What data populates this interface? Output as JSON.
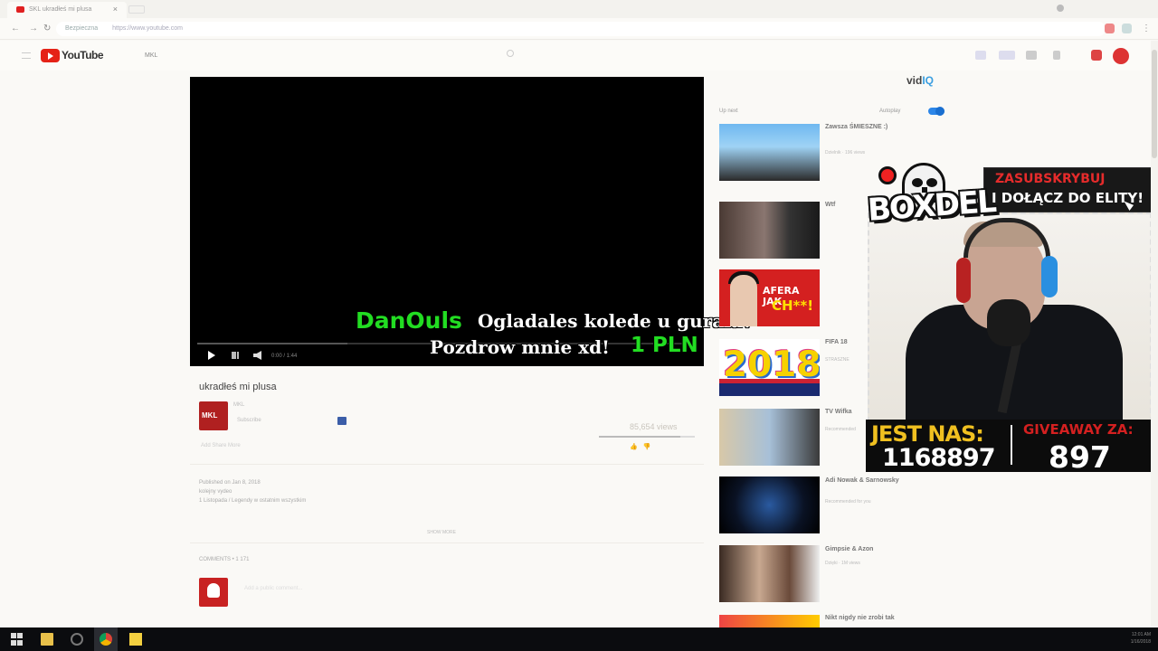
{
  "browser": {
    "tab_title": "SKL ukradłeś mi plusa",
    "tab_close": "×",
    "secure_label": "Bezpieczna",
    "url": "https://www.youtube.com"
  },
  "youtube": {
    "logo_text": "YouTube",
    "search_value": "MKL"
  },
  "player": {
    "time_text": "0:00 / 1:44",
    "progress_fraction": 0.3
  },
  "donation": {
    "donor": "DanOuls",
    "message_line1": "Ogladales kolede u gurala?",
    "message_line2": "Pozdrow mnie xd!",
    "amount": "1 PLN"
  },
  "video": {
    "title": "ukradłeś mi plusa",
    "channel_avatar_text": "MKL",
    "channel": "MKL",
    "subscribe_text": "Subscribe",
    "views": "85,654 views",
    "like_ratio": 0.85,
    "actions": "Add  Share  More",
    "published": "Published on Jan 8, 2018",
    "desc_line1": "kolejny vydeo",
    "desc_line2": "1 Listopada / Legendy w ostatnim wszystkim",
    "show_more": "SHOW MORE",
    "comments_header": "COMMENTS • 1 171",
    "comment_placeholder": "Add a public comment..."
  },
  "sidebar": {
    "vidiq_prefix": "vid",
    "vidiq_suffix": "IQ",
    "up_next": "Up next",
    "autoplay": "Autoplay",
    "items": [
      {
        "title": "Zawsza ŚMIESZNE :)",
        "meta": "Dzielnik · 196 views"
      },
      {
        "title": "Wtf",
        "meta": ""
      },
      {
        "title": "",
        "meta": ""
      },
      {
        "title": "FIFA 18",
        "meta": "STRASZNE"
      },
      {
        "title": "TV Wifka",
        "meta": "Recommended"
      },
      {
        "title": "Adi Nowak & Sarnowsky",
        "meta": "Recommended for you"
      },
      {
        "title": "Gimpsie & Azon",
        "meta": "Dzięki · 1M views"
      },
      {
        "title": "Nikt nigdy nie zrobi tak",
        "meta": ""
      }
    ],
    "thumb3_caption1": "AFERA JAK",
    "thumb3_caption2": "CH**!",
    "thumb4_year": "2018"
  },
  "overlay": {
    "logo": "BOXDEL",
    "banner_line1": "ZASUBSKRYBUJ",
    "banner_line2": "I DOŁĄCZ DO ELITY!",
    "jest_nas_label": "JEST NAS:",
    "jest_nas_count": "1168897",
    "giveaway_label": "GIVEAWAY ZA:",
    "giveaway_count": "897"
  },
  "taskbar": {
    "clock_time": "12:01 AM",
    "clock_date": "1/16/2018"
  },
  "colors": {
    "donor_green": "#22dd22",
    "youtube_red": "#e52217",
    "autoplay_blue": "#2c86e8",
    "jest_yellow": "#f0c020",
    "giveaway_red": "#d42020"
  }
}
